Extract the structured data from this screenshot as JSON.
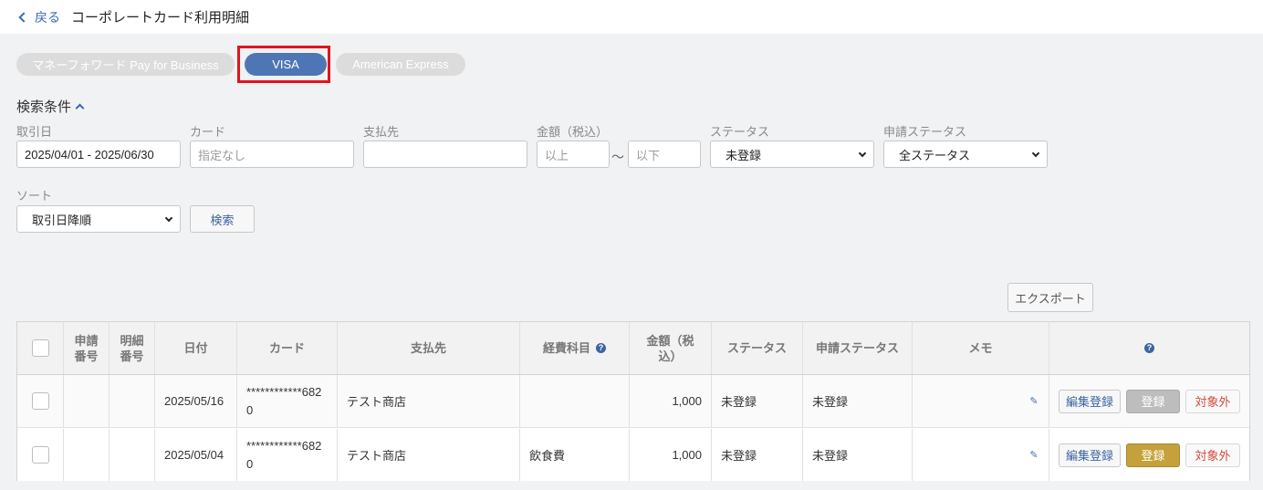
{
  "header": {
    "back_label": "戻る",
    "title": "コーポレートカード利用明細"
  },
  "card_tabs": [
    {
      "label": "マネーフォワード Pay for Business",
      "active": false
    },
    {
      "label": "VISA",
      "active": true
    },
    {
      "label": "American Express",
      "active": false
    }
  ],
  "search": {
    "title": "検索条件",
    "date": {
      "label": "取引日",
      "value": "2025/04/01 - 2025/06/30"
    },
    "card": {
      "label": "カード",
      "placeholder": "指定なし"
    },
    "payee": {
      "label": "支払先",
      "value": ""
    },
    "amount": {
      "label": "金額（税込）",
      "min_placeholder": "以上",
      "max_placeholder": "以下",
      "separator": "～"
    },
    "status": {
      "label": "ステータス",
      "value": "未登録"
    },
    "request_status": {
      "label": "申請ステータス",
      "value": "全ステータス"
    },
    "sort": {
      "label": "ソート",
      "value": "取引日降順"
    },
    "search_button": "検索"
  },
  "export_button": "エクスポート",
  "table": {
    "headers": {
      "request_no": "申請\n番号",
      "detail_no": "明細\n番号",
      "date": "日付",
      "card": "カード",
      "payee": "支払先",
      "account": "経費科目",
      "amount": "金額（税込）",
      "status": "ステータス",
      "request_status": "申請ステータス",
      "memo": "メモ"
    },
    "rows": [
      {
        "request_no": "",
        "detail_no": "",
        "date": "2025/05/16",
        "card": "************6820",
        "payee": "テスト商店",
        "account": "",
        "amount": "1,000",
        "status": "未登録",
        "request_status": "未登録",
        "edit_label": "編集登録",
        "register_label": "登録",
        "register_enabled": false,
        "exclude_label": "対象外"
      },
      {
        "request_no": "",
        "detail_no": "",
        "date": "2025/05/04",
        "card": "************6820",
        "payee": "テスト商店",
        "account": "飲食費",
        "amount": "1,000",
        "status": "未登録",
        "request_status": "未登録",
        "edit_label": "編集登録",
        "register_label": "登録",
        "register_enabled": true,
        "exclude_label": "対象外"
      }
    ]
  },
  "colors": {
    "accent": "#4f76b4",
    "highlight": "#e3131b",
    "register": "#c4a13a"
  }
}
